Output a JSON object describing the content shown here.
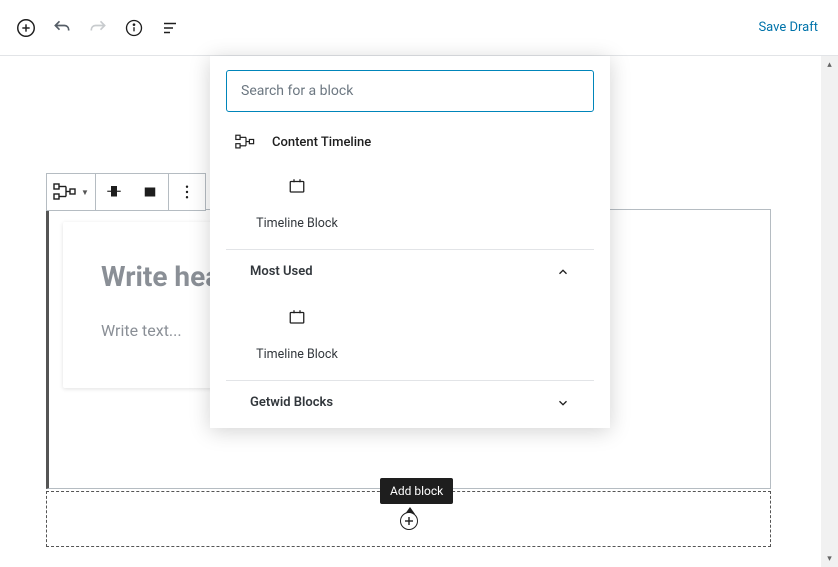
{
  "toolbar": {
    "save_draft": "Save Draft"
  },
  "inserter": {
    "search_placeholder": "Search for a block",
    "result1_label": "Content Timeline",
    "block1_label": "Timeline Block",
    "section_most_used": "Most Used",
    "block2_label": "Timeline Block",
    "section_getwid": "Getwid Blocks"
  },
  "card": {
    "heading_placeholder": "Write hea",
    "text_placeholder": "Write text..."
  },
  "tooltip": {
    "add_block": "Add block"
  }
}
